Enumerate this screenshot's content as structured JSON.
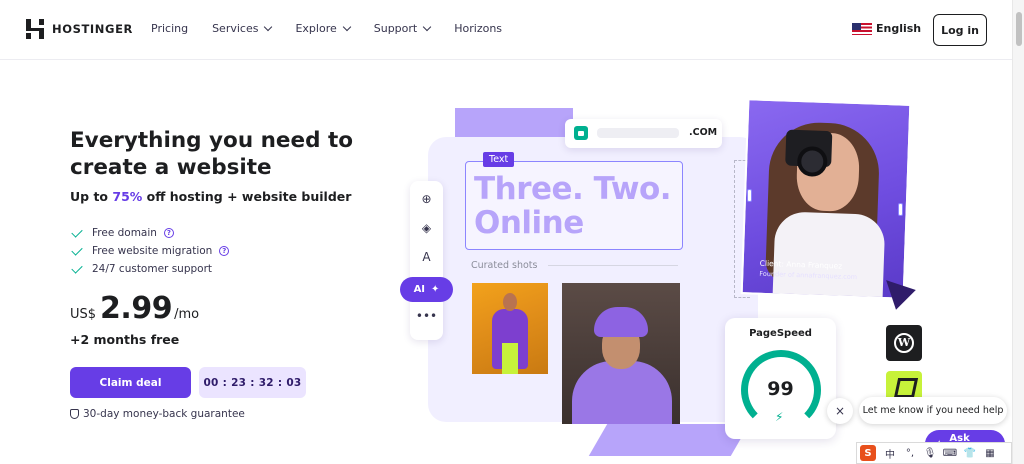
{
  "header": {
    "logo_text": "HOSTINGER",
    "nav": [
      {
        "label": "Pricing",
        "has_dropdown": false
      },
      {
        "label": "Services",
        "has_dropdown": true
      },
      {
        "label": "Explore",
        "has_dropdown": true
      },
      {
        "label": "Support",
        "has_dropdown": true
      },
      {
        "label": "Horizons",
        "has_dropdown": false
      }
    ],
    "language": "English",
    "login_label": "Log in"
  },
  "hero": {
    "title": "Everything you need to create a website",
    "subtitle_prefix": "Up to ",
    "subtitle_accent": "75%",
    "subtitle_suffix": " off hosting + website builder",
    "features": [
      {
        "label": "Free domain",
        "info": true
      },
      {
        "label": "Free website migration",
        "info": true
      },
      {
        "label": "24/7 customer support",
        "info": false
      }
    ],
    "currency": "US$",
    "price": "2.99",
    "period": "/mo",
    "bonus": "+2 months free",
    "cta_label": "Claim deal",
    "timer": "00 : 23 : 32 : 03",
    "guarantee": "30-day money-back guarantee"
  },
  "illustration": {
    "url_tld": ".COM",
    "text_tag": "Text",
    "big_text_line1": "Three. Two.",
    "big_text_line2": "Online",
    "curated_label": "Curated shots",
    "ai_label": "AI",
    "client_name": "Client: Anna Franquez",
    "client_role": "Founder of annafranquez.com",
    "pagespeed_label": "PageSpeed",
    "pagespeed_score": "99"
  },
  "chat": {
    "close_glyph": "×",
    "message": "Let me know if you need help",
    "ask_label": "Ask Kodee"
  },
  "ime": {
    "logo": "S",
    "chinese": "中"
  },
  "colors": {
    "brand": "#673de6",
    "brand_light": "#ebe4ff",
    "accent_green": "#00b090",
    "lime": "#c7f23a",
    "text_dark": "#1d1e20"
  }
}
